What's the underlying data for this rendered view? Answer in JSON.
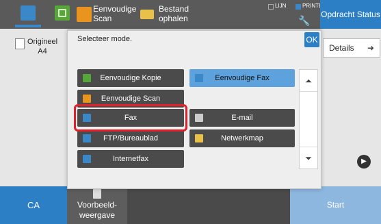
{
  "topbar": {
    "easy_scan_label": "Eenvoudige Scan",
    "retrieve_file_label": "Bestand ophalen",
    "line_indicator": "LIJN",
    "printer_indicator": "PRINTER",
    "job_status_label": "Opdracht Status"
  },
  "left_panel": {
    "original_label": "Origineel",
    "original_size": "A4"
  },
  "right_panel": {
    "details_label": "Details"
  },
  "dialog": {
    "title": "Selecteer mode.",
    "ok_label": "OK",
    "modes": [
      {
        "label": "Eenvoudige Kopie",
        "icon": "copy-icon",
        "icon_color": "#56a63a"
      },
      {
        "label": "Eenvoudige Fax",
        "icon": "fax-icon",
        "icon_color": "#3b88c8",
        "selected": true
      },
      {
        "label": "Eenvoudige Scan",
        "icon": "scan-icon",
        "icon_color": "#e8941e"
      },
      {
        "label": "Fax",
        "icon": "fax-icon",
        "icon_color": "#3b88c8"
      },
      {
        "label": "E-mail",
        "icon": "mail-icon",
        "icon_color": "#cccccc"
      },
      {
        "label": "FTP/Bureaublad",
        "icon": "ftp-icon",
        "icon_color": "#3b88c8"
      },
      {
        "label": "Netwerkmap",
        "icon": "folder-icon",
        "icon_color": "#e8c04a"
      },
      {
        "label": "Internetfax",
        "icon": "internet-fax-icon",
        "icon_color": "#3b88c8"
      }
    ]
  },
  "bottombar": {
    "ca_label": "CA",
    "preview_label": "Voorbeeld-weergave",
    "start_label": "Start"
  },
  "colors": {
    "accent_blue": "#2c7fc4",
    "highlight_red": "#e0202a",
    "selected_blue": "#5ea2dd"
  }
}
